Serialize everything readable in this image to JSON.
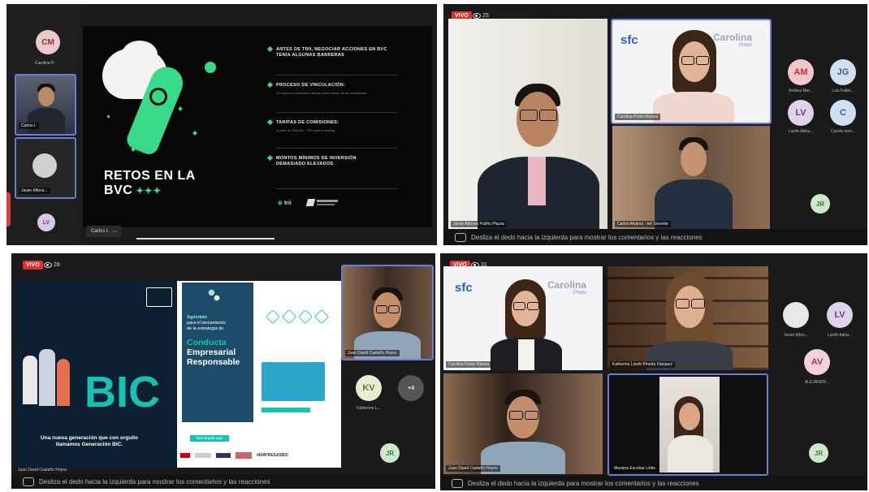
{
  "panel1": {
    "sidebar": [
      {
        "initials": "CM",
        "name": "Carolina P.",
        "bg": "#e9c9c9",
        "fg": "#a03030"
      },
      {
        "name": "Carlos I."
      },
      {
        "name": "Javier Alfons...",
        "bg": "#d0d0d0"
      },
      {
        "initials": "LV",
        "bg": "#d9c8e6",
        "fg": "#6a3d8a"
      }
    ],
    "slide": {
      "title_line1": "RETOS EN LA",
      "title_line2": "BVC",
      "bullets": [
        {
          "title": "ANTES DE TRII, NEGOCIAR ACCIONES EN BVC TENÍA ALGUNAS BARRERAS",
          "sub": ""
        },
        {
          "title": "PROCESO DE VINCULACIÓN:",
          "sub": "Se requería vinculación directa como cliente de la comisionista"
        },
        {
          "title": "TARIFAS DE COMISIONES:",
          "sub": "A partir de $25,000 - 75% para el trading"
        },
        {
          "title": "MONTOS MÍNIMOS DE INVERSIÓN DEMASIADO ELEVADOS.",
          "sub": ""
        }
      ],
      "logo1": "trii"
    },
    "presenter_chip": "Carlos I."
  },
  "panel2": {
    "live": "VIVO",
    "views": "25",
    "tiles": [
      {
        "name": "Javier Alfonso Patiño Plazas"
      },
      {
        "name": "Carolina Prieto Ramos",
        "brand": "sfc",
        "brand2": "Carolina",
        "brand3": "Prieto"
      },
      {
        "name": "Carlos Alvarez - tel: Gerente"
      }
    ],
    "side": [
      {
        "initials": "AM",
        "name": "Andrea Mar...",
        "bg": "#f1c7c7",
        "fg": "#b03a3a"
      },
      {
        "initials": "JG",
        "name": "Luis Fabio...",
        "bg": "#cfe0f3",
        "fg": "#3a5f8a"
      },
      {
        "initials": "LV",
        "name": "Lizeth Adria...",
        "bg": "#dfd3ec",
        "fg": "#6a3d8a"
      },
      {
        "initials": "C",
        "name": "Carola mon...",
        "bg": "#cfe0f3",
        "fg": "#3a5f8a"
      },
      {
        "initials": "JR",
        "bg": "#cfe7cf",
        "fg": "#3c7a3c"
      }
    ],
    "chat": "Desliza el dedo hacia la izquierda para mostrar los comentarios y las reacciones"
  },
  "panel3": {
    "live": "VIVO",
    "views": "28",
    "slide": {
      "big": "BIC",
      "caption": "Una nueva generación que con orgullo llamamos Generación BIC.",
      "agenda_lines": [
        "Agéndate",
        "para el lanzamiento",
        "de la estrategia de"
      ],
      "heading": [
        "Conducta",
        "Empresarial",
        "Responsable"
      ],
      "button": "Descárgala aquí",
      "footer_tag": "#EMPRESASBIC"
    },
    "tile": {
      "name": "Juan David Castaño Hoyos"
    },
    "side": [
      {
        "initials": "KV",
        "name": "Katherine L...",
        "bg": "#e8ecd1",
        "fg": "#6a7a2a"
      },
      {
        "initials": "+4",
        "bg": "#555",
        "fg": "#eee"
      },
      {
        "initials": "JR",
        "bg": "#cfe7cf",
        "fg": "#3c7a3c"
      }
    ],
    "chip": "Juan David Castaño Hoyos",
    "chat": "Desliza el dedo hacia la izquierda para mostrar los comentarios y las reacciones"
  },
  "panel4": {
    "live": "VIVO",
    "views": "31",
    "tiles": [
      {
        "name": "Carolina Prieto Ramos",
        "brand": "sfc",
        "brand2": "Carolina",
        "brand3": "Prieto"
      },
      {
        "name": "Katherine Lizeth Pineda Vázquez"
      },
      {
        "name": "Juan David Castaño Hoyos"
      },
      {
        "name": "Mariana Escobar Uribe"
      }
    ],
    "side": [
      {
        "name": "Javier Alfon...",
        "bg": "#e8e8e8"
      },
      {
        "initials": "LV",
        "name": "Lizeth Adria...",
        "bg": "#dfd3ec",
        "fg": "#6a3d8a"
      },
      {
        "initials": "AV",
        "name": "ALEJANDR...",
        "bg": "#f3d0dc",
        "fg": "#a03a5a"
      },
      {
        "initials": "JR",
        "bg": "#cfe7cf",
        "fg": "#3c7a3c"
      }
    ],
    "chat": "Desliza el dedo hacia la izquierda para mostrar los comentarios y las reacciones"
  }
}
